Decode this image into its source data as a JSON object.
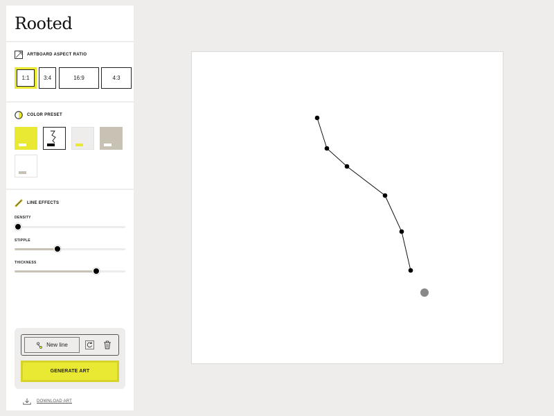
{
  "app": {
    "title": "Rooted"
  },
  "aspect": {
    "label": "ARTBOARD ASPECT RATIO",
    "options": [
      "1:1",
      "3:4",
      "16:9",
      "4:3"
    ],
    "selected": "1:1"
  },
  "colors": {
    "label": "COLOR PRESET",
    "accent": "#e9e832",
    "presets": [
      {
        "name": "yellow",
        "bg": "#e9e832",
        "chip": "#ffffff",
        "border": "#e9e832"
      },
      {
        "name": "white-black",
        "bg": "#ffffff",
        "chip": "#000000",
        "border": "#222222"
      },
      {
        "name": "light-gray",
        "bg": "#efedeb",
        "chip": "#e9e832",
        "border": "#e4e2df"
      },
      {
        "name": "taupe",
        "bg": "#c8c2b4",
        "chip": "#ffffff",
        "border": "#c8c2b4"
      },
      {
        "name": "white-gray",
        "bg": "#ffffff",
        "chip": "#c8c2b4",
        "border": "#e4e2df"
      }
    ]
  },
  "effects": {
    "label": "LINE EFFECTS",
    "sliders": [
      {
        "key": "density",
        "label": "DENSITY",
        "value": 0.03
      },
      {
        "key": "stipple",
        "label": "STIPPLE",
        "value": 0.39
      },
      {
        "key": "thickness",
        "label": "THICKNESS",
        "value": 0.74
      }
    ]
  },
  "tools": {
    "new_line": "New line",
    "reset_icon": "refresh-icon",
    "delete_icon": "trash-icon",
    "generate": "GENERATE ART",
    "download": "DOWNLOAD ART"
  }
}
